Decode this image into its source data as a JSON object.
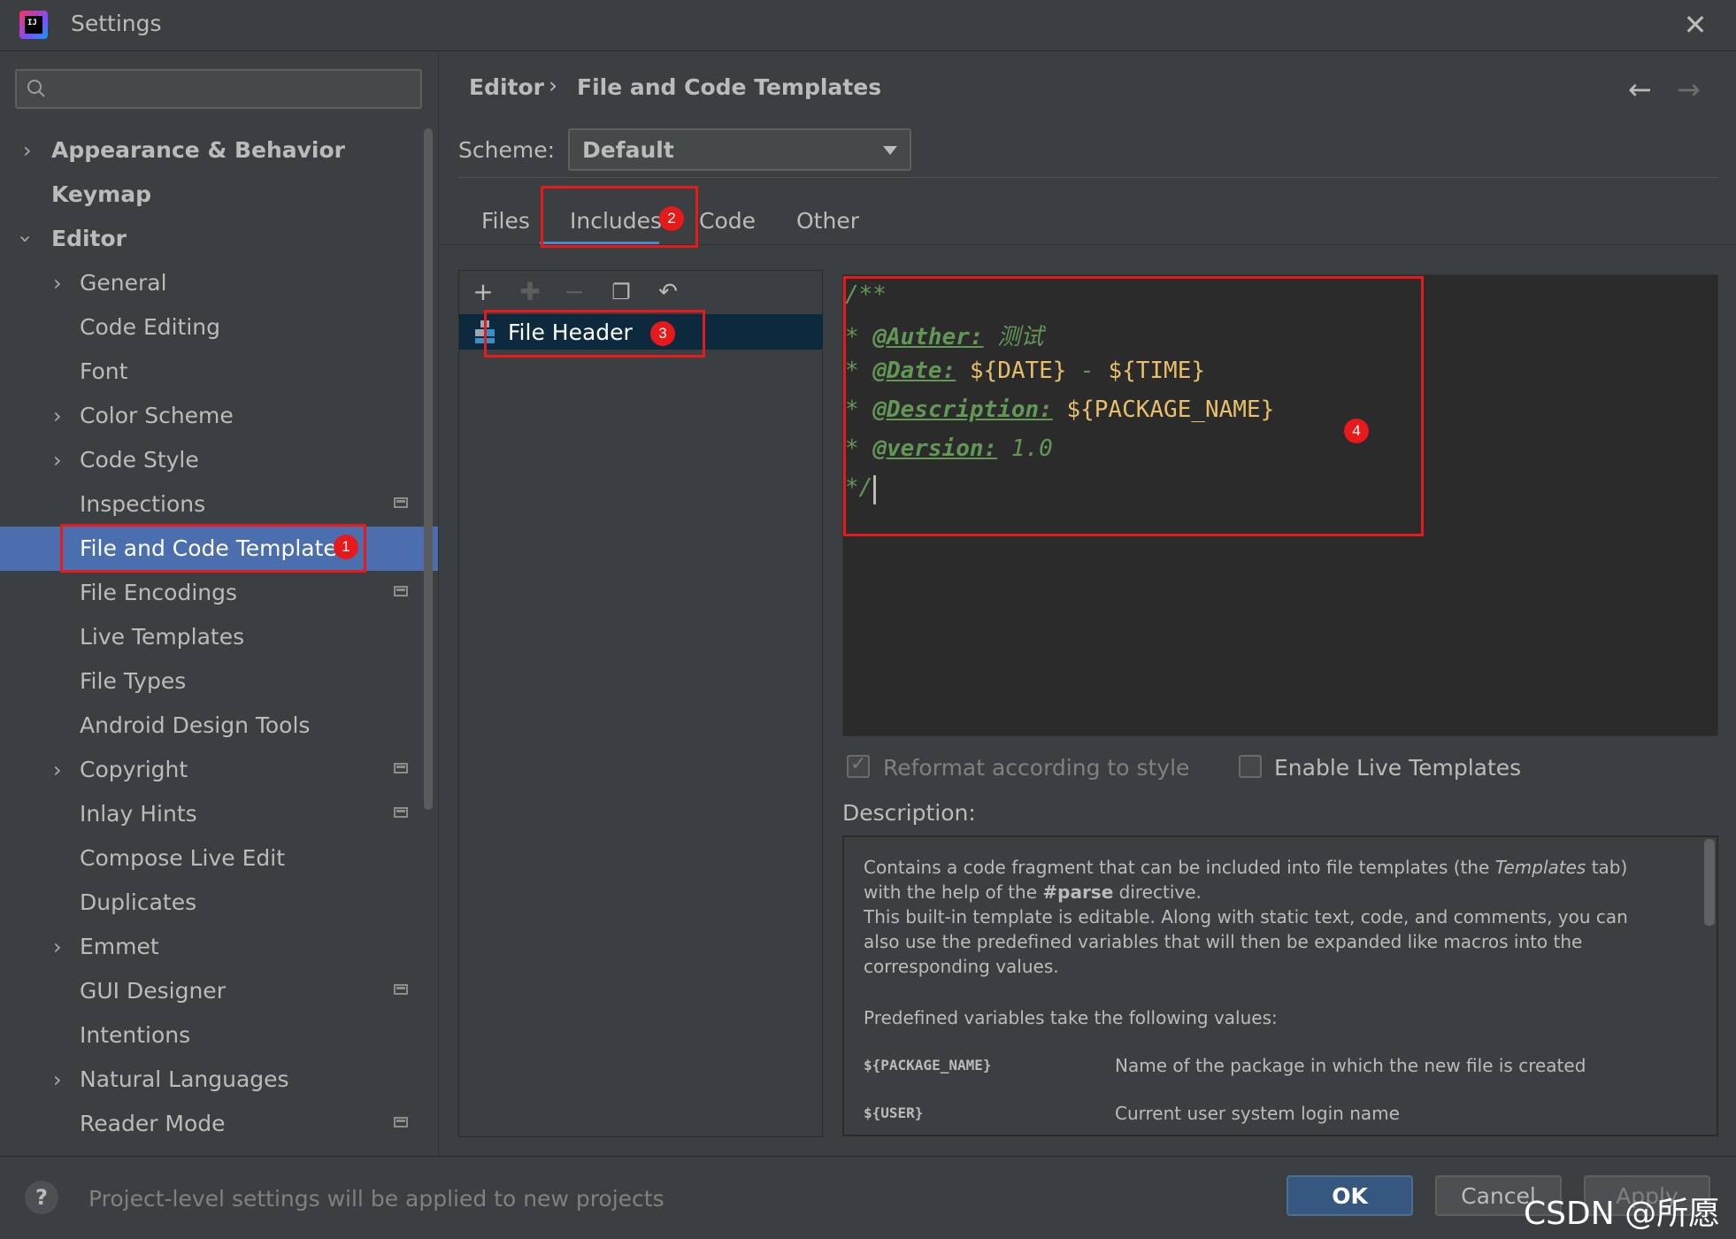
{
  "window": {
    "title": "Settings"
  },
  "search": {
    "placeholder": ""
  },
  "sidebar": {
    "items": [
      {
        "label": "Appearance & Behavior"
      },
      {
        "label": "Keymap"
      },
      {
        "label": "Editor"
      },
      {
        "label": "General"
      },
      {
        "label": "Code Editing"
      },
      {
        "label": "Font"
      },
      {
        "label": "Color Scheme"
      },
      {
        "label": "Code Style"
      },
      {
        "label": "Inspections"
      },
      {
        "label": "File and Code Templates"
      },
      {
        "label": "File Encodings"
      },
      {
        "label": "Live Templates"
      },
      {
        "label": "File Types"
      },
      {
        "label": "Android Design Tools"
      },
      {
        "label": "Copyright"
      },
      {
        "label": "Inlay Hints"
      },
      {
        "label": "Compose Live Edit"
      },
      {
        "label": "Duplicates"
      },
      {
        "label": "Emmet"
      },
      {
        "label": "GUI Designer"
      },
      {
        "label": "Intentions"
      },
      {
        "label": "Natural Languages"
      },
      {
        "label": "Reader Mode"
      }
    ]
  },
  "breadcrumb": {
    "parent": "Editor",
    "separator": "›",
    "current": "File and Code Templates"
  },
  "scheme": {
    "label": "Scheme:",
    "value": "Default"
  },
  "tabs": [
    {
      "label": "Files"
    },
    {
      "label": "Includes"
    },
    {
      "label": "Code"
    },
    {
      "label": "Other"
    }
  ],
  "templates": {
    "items": [
      {
        "label": "File Header"
      }
    ]
  },
  "editor": {
    "line1": "/**",
    "line2_prefix": "* ",
    "line2_tag": "@Auther:",
    "line2_value": " 测试",
    "line3_prefix": "* ",
    "line3_tag": "@Date:",
    "line3_var1": " ${DATE}",
    "line3_dash": " - ",
    "line3_var2": "${TIME}",
    "line4_prefix": "* ",
    "line4_tag": "@Description:",
    "line4_var": " ${PACKAGE_NAME}",
    "line5_prefix": "* ",
    "line5_tag": "@version:",
    "line5_value": " 1.0",
    "line6": "*/"
  },
  "options": {
    "reformat_label": "Reformat according to style",
    "reformat_checked": true,
    "live_templates_label": "Enable Live Templates",
    "live_templates_checked": false
  },
  "description": {
    "label": "Description:",
    "p1_a": "Contains a code fragment that can be included into file templates (the ",
    "p1_em": "Templates",
    "p1_b": " tab) with the help of the ",
    "p1_strong": "#parse",
    "p1_c": " directive.",
    "p2": "This built-in template is editable. Along with static text, code, and comments, you can also use the predefined variables that will then be expanded like macros into the corresponding values.",
    "p3": "Predefined variables take the following values:",
    "vars": [
      {
        "name": "${PACKAGE_NAME}",
        "desc": "Name of the package in which the new file is created"
      },
      {
        "name": "${USER}",
        "desc": "Current user system login name"
      }
    ]
  },
  "annotations": [
    "1",
    "2",
    "3",
    "4"
  ],
  "footer": {
    "hint": "Project-level settings will be applied to new projects",
    "ok": "OK",
    "cancel": "Cancel",
    "apply": "Apply"
  },
  "watermark": "CSDN @所愿",
  "colors": {
    "accent": "#4b6eaf",
    "highlight_red": "#e8191a",
    "ok_button": "#365880"
  }
}
